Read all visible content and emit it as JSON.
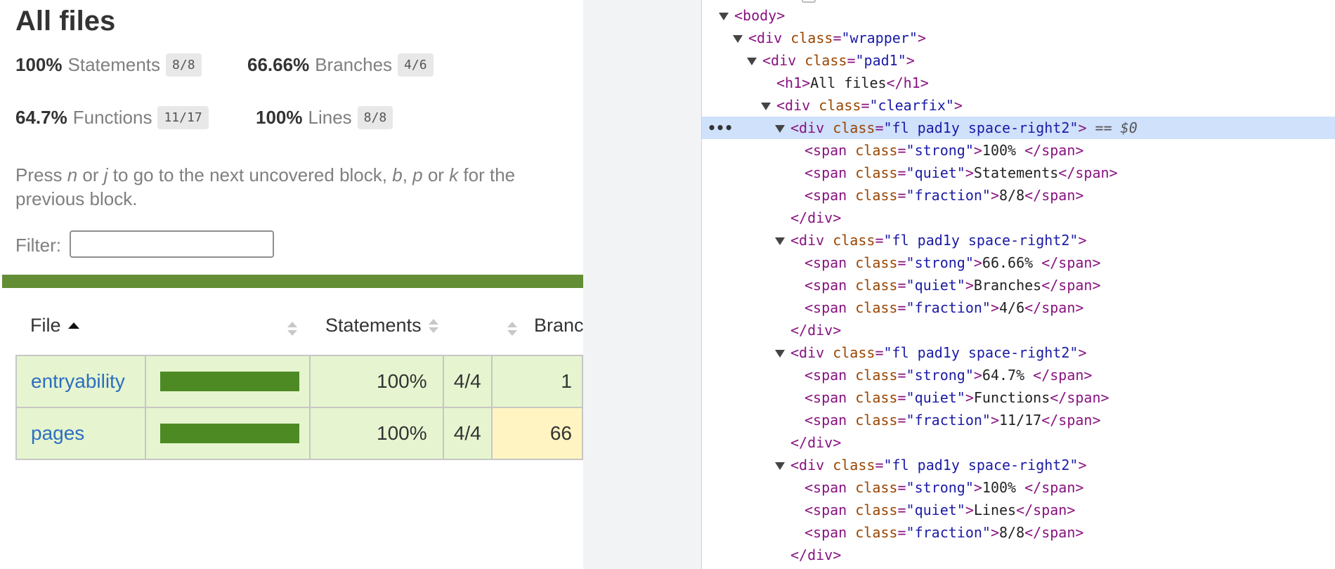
{
  "page": {
    "title": "All files",
    "stats": [
      {
        "strong": "100%",
        "quiet": "Statements",
        "fraction": "8/8"
      },
      {
        "strong": "66.66%",
        "quiet": "Branches",
        "fraction": "4/6"
      },
      {
        "strong": "64.7%",
        "quiet": "Functions",
        "fraction": "11/17"
      },
      {
        "strong": "100%",
        "quiet": "Lines",
        "fraction": "8/8"
      }
    ],
    "help": {
      "t1": "Press ",
      "n": "n",
      "t2": " or ",
      "j": "j",
      "t3": " to go to the next uncovered block, ",
      "b": "b",
      "t4": ", ",
      "p": "p",
      "t5": " or ",
      "k": "k",
      "t6": " for the previous block."
    },
    "filter": {
      "label": "Filter:",
      "value": ""
    },
    "table": {
      "headers": {
        "file": "File",
        "statements": "Statements",
        "branches": "Branc"
      },
      "rows": [
        {
          "name": "entryability",
          "coverage_pct": 100,
          "statements_pct": "100%",
          "statements_abs": "4/4",
          "branches_pct": "1"
        },
        {
          "name": "pages",
          "coverage_pct": 100,
          "statements_pct": "100%",
          "statements_abs": "4/4",
          "branches_pct": "66"
        }
      ]
    }
  },
  "devtools": {
    "lines": [
      {
        "t": "<body>"
      },
      {
        "t": "<div class=\"wrapper\">"
      },
      {
        "t": "<div class=\"pad1\">"
      },
      {
        "t": "<h1>All files</h1>"
      },
      {
        "t": "<div class=\"clearfix\">"
      },
      {
        "t": "<div class=\"fl pad1y space-right2\">",
        "selected_suffix": " == $0"
      },
      {
        "t": "<span class=\"strong\">100% </span>"
      },
      {
        "t": "<span class=\"quiet\">Statements</span>"
      },
      {
        "t": "<span class=\"fraction\">8/8</span>"
      },
      {
        "t": "</div>"
      },
      {
        "t": "<div class=\"fl pad1y space-right2\">"
      },
      {
        "t": "<span class=\"strong\">66.66% </span>"
      },
      {
        "t": "<span class=\"quiet\">Branches</span>"
      },
      {
        "t": "<span class=\"fraction\">4/6</span>"
      },
      {
        "t": "</div>"
      },
      {
        "t": "<div class=\"fl pad1y space-right2\">"
      },
      {
        "t": "<span class=\"strong\">64.7% </span>"
      },
      {
        "t": "<span class=\"quiet\">Functions</span>"
      },
      {
        "t": "<span class=\"fraction\">11/17</span>"
      },
      {
        "t": "</div>"
      },
      {
        "t": "<div class=\"fl pad1y space-right2\">"
      },
      {
        "t": "<span class=\"strong\">100% </span>"
      },
      {
        "t": "<span class=\"quiet\">Lines</span>"
      },
      {
        "t": "<span class=\"fraction\">8/8</span>"
      },
      {
        "t": "</div>"
      }
    ],
    "more_menu": "•••"
  },
  "colors": {
    "status_green": "#648e36",
    "row_high": "#e6f5d0",
    "row_medium": "#fff4c2",
    "selected_line": "#cfe1fb"
  }
}
